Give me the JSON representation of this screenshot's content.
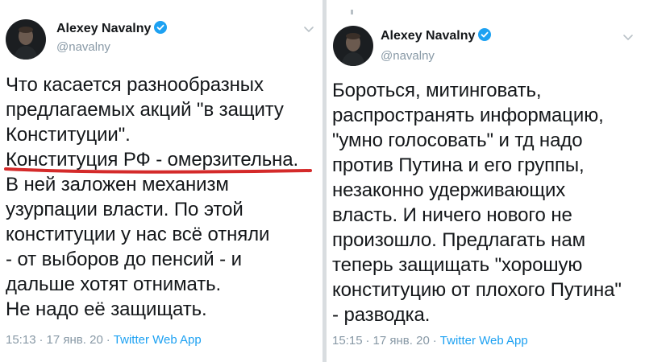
{
  "tweets": [
    {
      "user": {
        "name": "Alexey Navalny",
        "handle": "@navalny"
      },
      "body_lines": [
        "Что касается разнообразных",
        "предлагаемых акций \"в защиту",
        "Конституции\".",
        "Конституция РФ - омерзительна.",
        "В ней заложен механизм",
        "узурпации власти. По этой",
        "конституции у нас всё отняли",
        "- от выборов до пенсий - и",
        "дальше хотят отнимать.",
        "Не надо её защищать."
      ],
      "time": "15:13",
      "date": "17 янв. 20",
      "source": "Twitter Web App",
      "separator": "·"
    },
    {
      "user": {
        "name": "Alexey Navalny",
        "handle": "@navalny"
      },
      "body_lines": [
        "Бороться, митинговать,",
        "распространять информацию,",
        "\"умно голосовать\" и тд надо",
        "против Путина и его группы,",
        "незаконно удерживающих",
        "власть. И ничего нового не",
        "произошло. Предлагать нам",
        "теперь защищать \"хорошую",
        "конституцию от плохого Путина\"",
        "- разводка."
      ],
      "time": "15:15",
      "date": "17 янв. 20",
      "source": "Twitter Web App",
      "separator": "·"
    }
  ],
  "colors": {
    "text": "#14171a",
    "secondary": "#8899a6",
    "link": "#1da1f2",
    "verified": "#1da1f2",
    "highlight_underline": "#d42a2a",
    "divider": "#d9dde0"
  },
  "icons": {
    "verified": "verified-badge-icon",
    "menu": "chevron-down-icon"
  }
}
